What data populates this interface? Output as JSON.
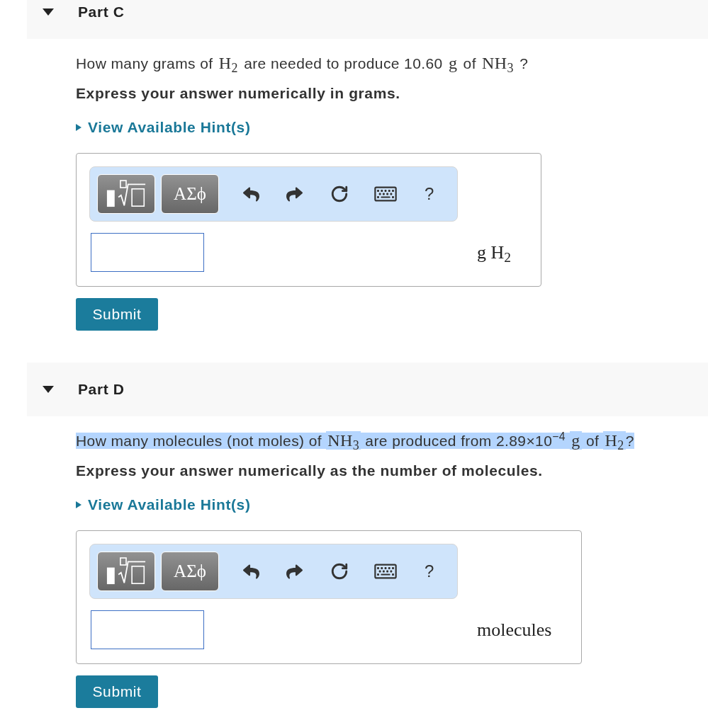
{
  "parts": [
    {
      "title": "Part C",
      "expanded": true,
      "question": {
        "highlighted": false,
        "segments": [
          {
            "kind": "text",
            "text": "How many grams of "
          },
          {
            "kind": "math",
            "text": "H$_{2}$"
          },
          {
            "kind": "text",
            "text": " are needed to produce 10.60 "
          },
          {
            "kind": "math",
            "text": "g"
          },
          {
            "kind": "text",
            "text": " of "
          },
          {
            "kind": "math",
            "text": "NH$_{3}$"
          },
          {
            "kind": "text",
            "text": " ?"
          }
        ]
      },
      "instruction": "Express your answer numerically in grams.",
      "hint_link": "View Available Hint(s)",
      "answer": {
        "toolbar": {
          "symbols_button": "ΑΣϕ",
          "help_button": "?"
        },
        "units": "g H$_{2}$"
      },
      "submit": "Submit"
    },
    {
      "title": "Part D",
      "expanded": true,
      "question": {
        "highlighted": true,
        "segments": [
          {
            "kind": "text",
            "text": "How many molecules (not moles) of "
          },
          {
            "kind": "math",
            "text": "NH$_{3}$"
          },
          {
            "kind": "text",
            "text": " are produced from 2.89×10$^{−4}$ "
          },
          {
            "kind": "math",
            "text": "g"
          },
          {
            "kind": "text",
            "text": " of "
          },
          {
            "kind": "math",
            "text": "H$_{2}$"
          },
          {
            "kind": "text",
            "text": "?"
          }
        ]
      },
      "instruction": "Express your answer numerically as the number of molecules.",
      "hint_link": "View Available Hint(s)",
      "answer": {
        "toolbar": {
          "symbols_button": "ΑΣϕ",
          "help_button": "?"
        },
        "units": "molecules"
      },
      "submit": "Submit"
    }
  ]
}
